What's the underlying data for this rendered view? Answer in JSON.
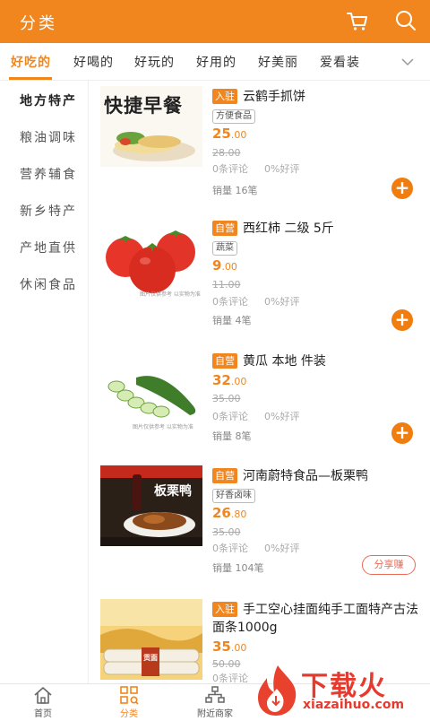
{
  "header": {
    "title": "分类",
    "cart_icon": "cart-icon",
    "search_icon": "search-icon",
    "bg_color": "#f2861e"
  },
  "tabs": {
    "items": [
      {
        "label": "好吃的",
        "active": true
      },
      {
        "label": "好喝的",
        "active": false
      },
      {
        "label": "好玩的",
        "active": false
      },
      {
        "label": "好用的",
        "active": false
      },
      {
        "label": "好美丽",
        "active": false
      },
      {
        "label": "爱看装",
        "active": false
      }
    ],
    "expand_icon": "chevron-down-icon"
  },
  "sidebar": {
    "items": [
      {
        "label": "地方特产",
        "active": true
      },
      {
        "label": "粮油调味",
        "active": false
      },
      {
        "label": "营养辅食",
        "active": false
      },
      {
        "label": "新乡特产",
        "active": false
      },
      {
        "label": "产地直供",
        "active": false
      },
      {
        "label": "休闲食品",
        "active": false
      }
    ]
  },
  "products": [
    {
      "badge": "入驻",
      "name": "云鹤手抓饼",
      "tag": "方便食品",
      "price_int": "25",
      "price_dec": ".00",
      "old_price": "28.00",
      "reviews": "0条评论",
      "rating": "0%好评",
      "sales": "销量 16笔",
      "action": "add",
      "image_text": "快捷早餐"
    },
    {
      "badge": "自营",
      "name": "西红柿 二级 5斤",
      "tag": "蔬菜",
      "price_int": "9",
      "price_dec": ".00",
      "old_price": "11.00",
      "reviews": "0条评论",
      "rating": "0%好评",
      "sales": "销量 4笔",
      "action": "add",
      "image_text": "图片仅供参考 以实物为准"
    },
    {
      "badge": "自营",
      "name": "黄瓜 本地 件装",
      "tag": "",
      "price_int": "32",
      "price_dec": ".00",
      "old_price": "35.00",
      "reviews": "0条评论",
      "rating": "0%好评",
      "sales": "销量 8笔",
      "action": "add",
      "image_text": "图片仅供参考 以实物为准"
    },
    {
      "badge": "自营",
      "name": "河南蔚特食品—板栗鸭",
      "tag": "好香卤味",
      "price_int": "26",
      "price_dec": ".80",
      "old_price": "35.00",
      "reviews": "0条评论",
      "rating": "0%好评",
      "sales": "销量 104笔",
      "action": "share",
      "action_label": "分享赚",
      "image_text": "板栗鸭"
    },
    {
      "badge": "入驻",
      "name": "手工空心挂面纯手工面特产古法面条1000g",
      "tag": "",
      "price_int": "35",
      "price_dec": ".00",
      "old_price": "50.00",
      "reviews": "0条评论",
      "rating": "",
      "sales": "",
      "action": "",
      "image_text": "贡面"
    }
  ],
  "bottom_nav": [
    {
      "label": "首页",
      "icon": "home-icon",
      "active": false
    },
    {
      "label": "分类",
      "icon": "category-grid-icon",
      "active": true
    },
    {
      "label": "附近商家",
      "icon": "nearby-stores-icon",
      "active": false
    }
  ],
  "watermark": {
    "text": "下载火",
    "url": "xiazaihuo.com"
  }
}
